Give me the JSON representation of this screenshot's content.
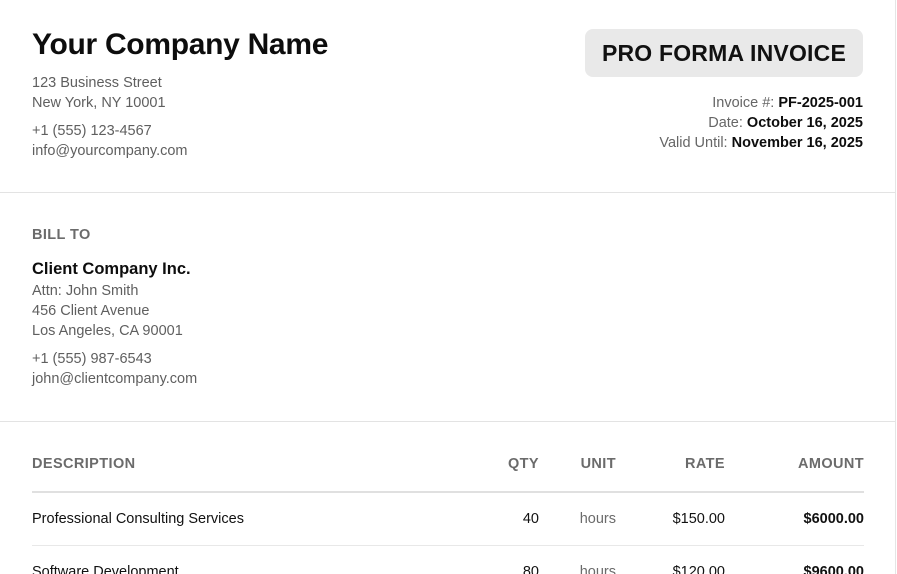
{
  "company": {
    "name": "Your Company Name",
    "street": "123 Business Street",
    "city": "New York, NY 10001",
    "phone": "+1 (555) 123-4567",
    "email": "info@yourcompany.com"
  },
  "invoice": {
    "title": "PRO FORMA INVOICE",
    "number_label": "Invoice #:",
    "number": "PF-2025-001",
    "date_label": "Date:",
    "date": "October 16, 2025",
    "valid_label": "Valid Until:",
    "valid_until": "November 16, 2025"
  },
  "bill_to": {
    "label": "BILL TO",
    "client_name": "Client Company Inc.",
    "attn": "Attn: John Smith",
    "street": "456 Client Avenue",
    "city": "Los Angeles, CA 90001",
    "phone": "+1 (555) 987-6543",
    "email": "john@clientcompany.com"
  },
  "items": {
    "headers": {
      "description": "DESCRIPTION",
      "qty": "QTY",
      "unit": "UNIT",
      "rate": "RATE",
      "amount": "AMOUNT"
    },
    "rows": [
      {
        "description": "Professional Consulting Services",
        "qty": "40",
        "unit": "hours",
        "rate": "$150.00",
        "amount": "$6000.00"
      },
      {
        "description": "Software Development",
        "qty": "80",
        "unit": "hours",
        "rate": "$120.00",
        "amount": "$9600.00"
      }
    ]
  }
}
